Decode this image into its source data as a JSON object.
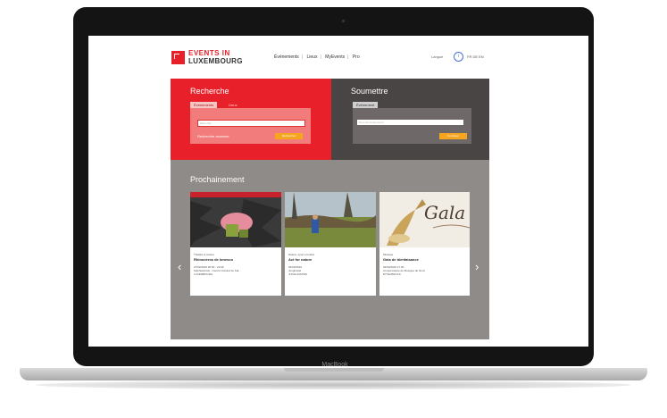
{
  "device": {
    "label": "MacBook"
  },
  "header": {
    "logo_line1": "EVENTS IN",
    "logo_line2": "LUXEMBOURG",
    "nav": [
      "Événements",
      "Lieux",
      "MyEvents",
      "Pro"
    ],
    "lang_label": "Langue",
    "lang_icon": "i",
    "lang_codes": "FR DE EN"
  },
  "search": {
    "title": "Recherche",
    "tab_events": "Événements",
    "tab_places": "Lieux",
    "input_placeholder": "Mots clés",
    "advanced_link": "Recherche avancée",
    "button_label": "Rechercher"
  },
  "submit": {
    "title": "Soumettre",
    "tab_event": "Événement",
    "input_placeholder": "Nom de l'événement",
    "button_label": "Continuer"
  },
  "upcoming": {
    "title": "Prochainement",
    "prev_icon": "‹",
    "next_icon": "›",
    "cards": [
      {
        "category": "Théâtre & culture",
        "title": "Rhinocéros de Ionesco",
        "d1": "27/02/2016 20:00 - 22:00",
        "d2": "Kalchesbrück - Centre Culturel de Kal...",
        "d3": "LUXEMBOURG"
      },
      {
        "category": "Nature, sport et loisirs",
        "title": "Act for nature",
        "d1": "02/03/2016",
        "d2": "Junglinster",
        "d3": "JUNGLINSTER"
      },
      {
        "category": "Musique",
        "title": "Gala de bienfaisance",
        "d1": "04/03/2016 17:00",
        "d2": "Conservatoire de Musique du Nord",
        "d3": "ETTELBRUCK"
      }
    ]
  },
  "colors": {
    "brand_red": "#e8202a",
    "dark_panel": "#4a4545",
    "upcoming_bg": "#8f8b89",
    "button_orange": "#f6a51e"
  }
}
